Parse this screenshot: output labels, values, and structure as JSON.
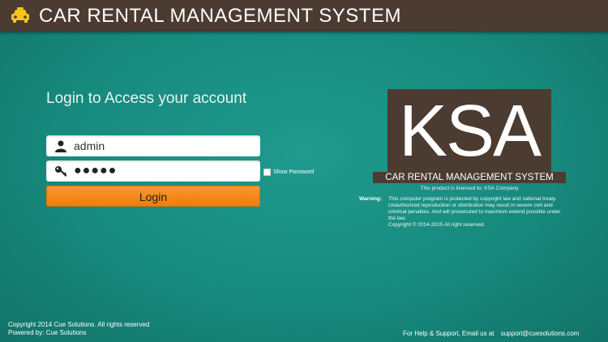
{
  "app": {
    "title": "CAR RENTAL MANAGEMENT SYSTEM",
    "icon": "car-icon"
  },
  "login": {
    "heading": "Login to Access your account",
    "username_value": "admin",
    "password_mask": "●●●●●",
    "show_password_label": "Show Password",
    "button_label": "Login"
  },
  "brand": {
    "logo_text": "KSA",
    "subtitle": "CAR RENTAL MANAGEMENT SYSTEM",
    "licensed_to": "This product is licensed to: KSA Company",
    "warning_label": "Warning:",
    "warning_text": "This computer program is protected by copyright law and national treaty. Unauthorized reproduction or distribution may result in severe civil and criminal penalties. And will prosecuted to maximum extend possible under the law.",
    "copyright_line": "Copyright © 2014-2015 All right reserved."
  },
  "footer": {
    "copyright": "Copyright 2014 Cue Solutions. All rights reserved",
    "powered_by": "Powered by: Cue Solutions",
    "help_text": "For Help & Support, Email us at",
    "help_email": "support@cuesolutions.com"
  },
  "colors": {
    "header_bg": "#4b3b31",
    "page_bg": "#178a7e",
    "accent_orange": "#ef7d0c",
    "car_yellow": "#f5c518"
  }
}
